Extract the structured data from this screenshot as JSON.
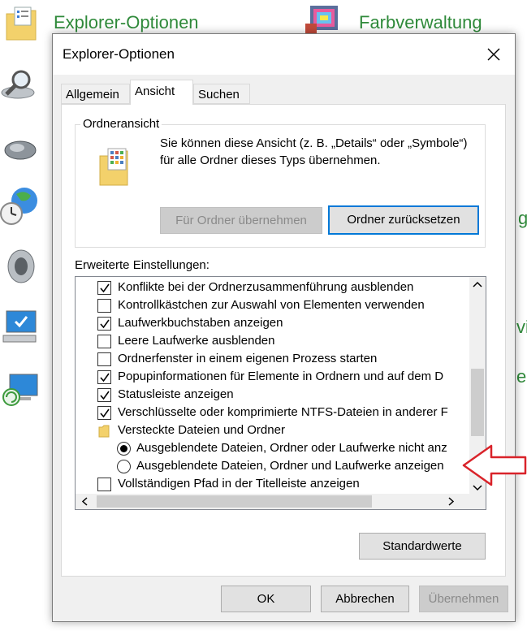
{
  "background": {
    "titles": [
      "Explorer-Optionen",
      "Farbverwaltung"
    ],
    "fragments": [
      "g",
      "vig",
      "er"
    ]
  },
  "dialog": {
    "title": "Explorer-Optionen",
    "tabs": [
      {
        "label": "Allgemein",
        "active": false
      },
      {
        "label": "Ansicht",
        "active": true
      },
      {
        "label": "Suchen",
        "active": false
      }
    ],
    "folder_view": {
      "legend": "Ordneransicht",
      "description": "Sie können diese Ansicht (z. B. „Details“ oder „Symbole“) für alle Ordner dieses Typs übernehmen.",
      "apply_button": "Für Ordner übernehmen",
      "reset_button": "Ordner zurücksetzen"
    },
    "advanced": {
      "label": "Erweiterte Einstellungen:",
      "items": [
        {
          "type": "checkbox",
          "checked": true,
          "label": "Konflikte bei der Ordnerzusammenführung ausblenden"
        },
        {
          "type": "checkbox",
          "checked": false,
          "label": "Kontrollkästchen zur Auswahl von Elementen verwenden"
        },
        {
          "type": "checkbox",
          "checked": true,
          "label": "Laufwerkbuchstaben anzeigen"
        },
        {
          "type": "checkbox",
          "checked": false,
          "label": "Leere Laufwerke ausblenden"
        },
        {
          "type": "checkbox",
          "checked": false,
          "label": "Ordnerfenster in einem eigenen Prozess starten"
        },
        {
          "type": "checkbox",
          "checked": true,
          "label": "Popupinformationen für Elemente in Ordnern und auf dem D"
        },
        {
          "type": "checkbox",
          "checked": true,
          "label": "Statusleiste anzeigen"
        },
        {
          "type": "checkbox",
          "checked": true,
          "label": "Verschlüsselte oder komprimierte NTFS-Dateien in anderer F"
        },
        {
          "type": "folder",
          "label": "Versteckte Dateien und Ordner"
        },
        {
          "type": "radio",
          "checked": true,
          "label": "Ausgeblendete Dateien, Ordner oder Laufwerke nicht anz"
        },
        {
          "type": "radio",
          "checked": false,
          "label": "Ausgeblendete Dateien, Ordner und Laufwerke anzeigen"
        },
        {
          "type": "checkbox",
          "checked": false,
          "label": "Vollständigen Pfad in der Titelleiste anzeigen"
        }
      ]
    },
    "defaults_button": "Standardwerte",
    "ok_button": "OK",
    "cancel_button": "Abbrechen",
    "apply_button": "Übernehmen"
  },
  "colors": {
    "accent": "#0078d7",
    "background_link": "#2f8a3a",
    "annotation_arrow": "#d9232a"
  }
}
